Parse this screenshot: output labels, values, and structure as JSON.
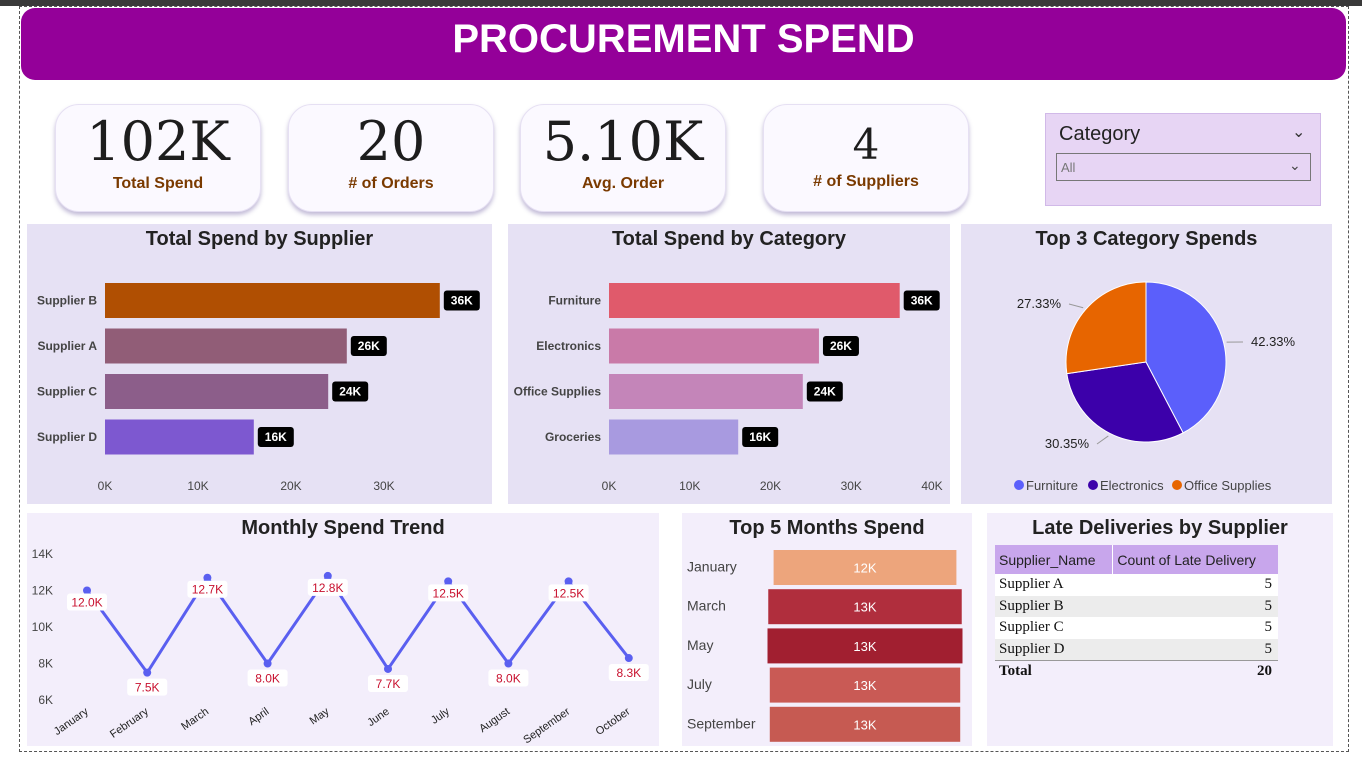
{
  "title": "PROCUREMENT SPEND",
  "kpis": [
    {
      "value": "102K",
      "label": "Total Spend"
    },
    {
      "value": "20",
      "label": "# of Orders"
    },
    {
      "value": "5.10K",
      "label": "Avg. Order"
    },
    {
      "value": "4",
      "label": "# of Suppliers"
    }
  ],
  "slicer": {
    "label": "Category",
    "value": "All",
    "chevron": "chevron-down-icon"
  },
  "charts": {
    "supplier": {
      "type": "bar",
      "orientation": "horizontal",
      "title": "Total Spend by Supplier",
      "categories": [
        "Supplier B",
        "Supplier A",
        "Supplier C",
        "Supplier D"
      ],
      "values": [
        36,
        26,
        24,
        16
      ],
      "value_labels": [
        "36K",
        "26K",
        "24K",
        "16K"
      ],
      "colors": [
        "#b04f02",
        "#915d77",
        "#8c5e8a",
        "#7d58d0"
      ],
      "xticks": [
        "0K",
        "10K",
        "20K",
        "30K"
      ],
      "xlim": [
        0,
        40
      ]
    },
    "category": {
      "type": "bar",
      "orientation": "horizontal",
      "title": "Total Spend by Category",
      "categories": [
        "Furniture",
        "Electronics",
        "Office Supplies",
        "Groceries"
      ],
      "values": [
        36,
        26,
        24,
        16
      ],
      "value_labels": [
        "36K",
        "26K",
        "24K",
        "16K"
      ],
      "colors": [
        "#e05a6b",
        "#c97aa8",
        "#c485b9",
        "#a89ae0"
      ],
      "xticks": [
        "0K",
        "10K",
        "20K",
        "30K",
        "40K"
      ],
      "xlim": [
        0,
        40
      ]
    },
    "pie": {
      "type": "pie",
      "title": "Top 3 Category Spends",
      "labels": [
        "Furniture",
        "Electronics",
        "Office Supplies"
      ],
      "values": [
        42.33,
        30.35,
        27.33
      ],
      "value_labels": [
        "42.33%",
        "30.35%",
        "27.33%"
      ],
      "colors": [
        "#5b5ffb",
        "#3c00aa",
        "#e76500"
      ],
      "legend_placement": "bottom"
    },
    "trend": {
      "type": "line",
      "title": "Monthly Spend Trend",
      "x": [
        "January",
        "February",
        "March",
        "April",
        "May",
        "June",
        "July",
        "August",
        "September",
        "October"
      ],
      "y": [
        12.0,
        7.5,
        12.7,
        8.0,
        12.8,
        7.7,
        12.5,
        8.0,
        12.5,
        8.3
      ],
      "value_labels": [
        "12.0K",
        "7.5K",
        "12.7K",
        "8.0K",
        "12.8K",
        "7.7K",
        "12.5K",
        "8.0K",
        "12.5K",
        "8.3K"
      ],
      "yticks": [
        "6K",
        "8K",
        "10K",
        "12K",
        "14K"
      ],
      "ylim": [
        6,
        14
      ],
      "color": "#5a5ff0",
      "label_color": "#c8102e"
    },
    "top5": {
      "type": "bar",
      "orientation": "horizontal",
      "title": "Top 5 Months Spend",
      "categories": [
        "January",
        "March",
        "May",
        "July",
        "September"
      ],
      "values": [
        12.0,
        12.7,
        12.8,
        12.5,
        12.5
      ],
      "value_labels": [
        "12K",
        "13K",
        "13K",
        "13K",
        "13K"
      ],
      "colors": [
        "#eda57c",
        "#b02e3d",
        "#a11f30",
        "#c95a55",
        "#c65a52"
      ]
    }
  },
  "late": {
    "title": "Late Deliveries by Supplier",
    "columns": [
      "Supplier_Name",
      "Count of Late Delivery"
    ],
    "rows": [
      [
        "Supplier A",
        "5"
      ],
      [
        "Supplier B",
        "5"
      ],
      [
        "Supplier C",
        "5"
      ],
      [
        "Supplier D",
        "5"
      ]
    ],
    "total": [
      "Total",
      "20"
    ]
  }
}
